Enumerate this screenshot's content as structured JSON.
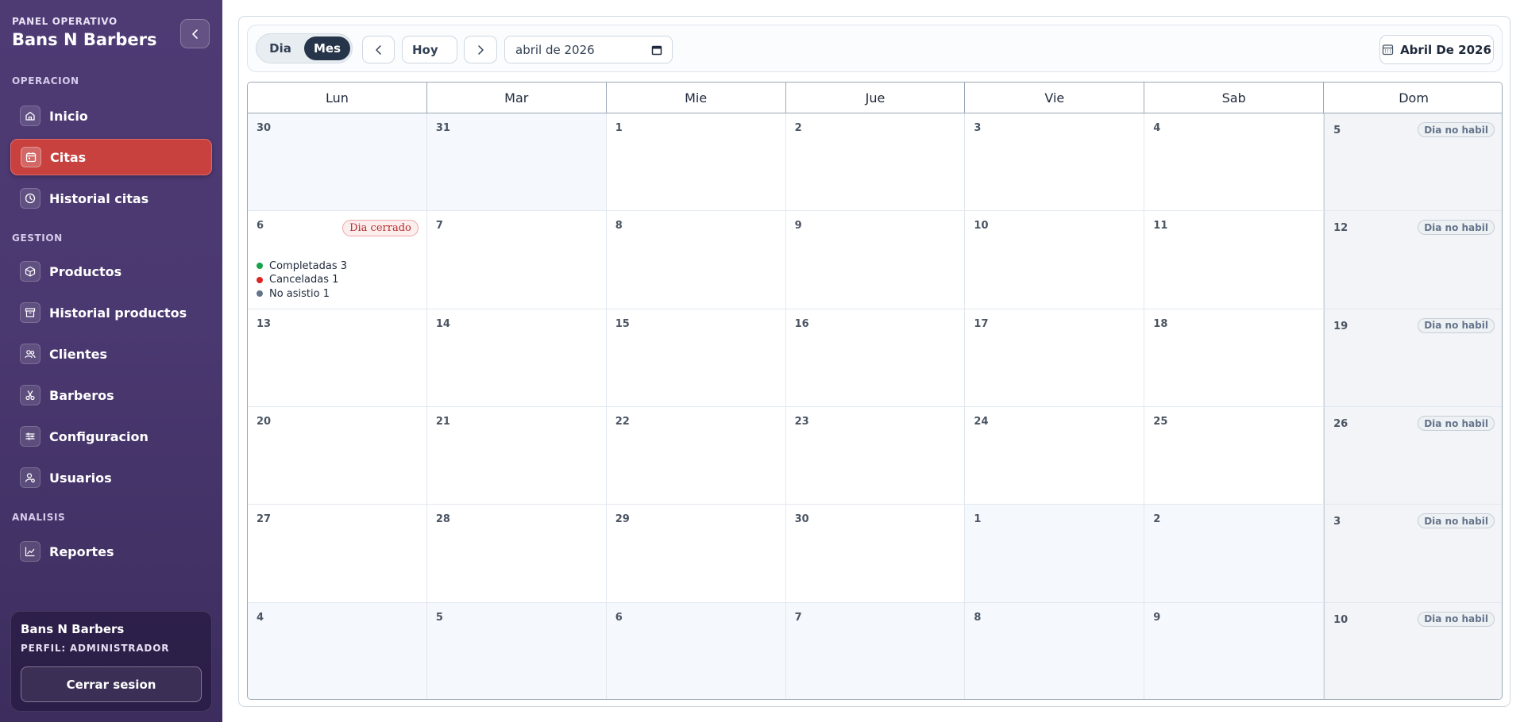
{
  "colors": {
    "sidebar_bg": "#4a3870",
    "active_item": "#c8413f",
    "toggle_active": "#263549",
    "status_completed": "#16a34a",
    "status_cancelled": "#dc2626",
    "status_noshow": "#64748b"
  },
  "sidebar": {
    "eyebrow": "PANEL OPERATIVO",
    "title": "Bans N Barbers",
    "sections": {
      "operacion": "OPERACION",
      "gestion": "GESTION",
      "analisis": "ANALISIS"
    },
    "items": [
      {
        "label": "Inicio",
        "icon": "home-icon"
      },
      {
        "label": "Citas",
        "icon": "calendar-icon",
        "active": true
      },
      {
        "label": "Historial citas",
        "icon": "clock-icon"
      },
      {
        "label": "Productos",
        "icon": "box-icon"
      },
      {
        "label": "Historial productos",
        "icon": "archive-icon"
      },
      {
        "label": "Clientes",
        "icon": "users-icon"
      },
      {
        "label": "Barberos",
        "icon": "scissors-icon"
      },
      {
        "label": "Configuracion",
        "icon": "sliders-icon"
      },
      {
        "label": "Usuarios",
        "icon": "user-cog-icon"
      },
      {
        "label": "Reportes",
        "icon": "chart-line-icon"
      }
    ],
    "profile": {
      "name": "Bans N Barbers",
      "role": "PERFIL: ADMINISTRADOR",
      "logout": "Cerrar sesion"
    }
  },
  "toolbar": {
    "view_day": "Dia",
    "view_month": "Mes",
    "today": "Hoy",
    "date_value": "abril de 2026",
    "month_badge": "Abril De 2026"
  },
  "calendar": {
    "weekdays": [
      "Lun",
      "Mar",
      "Mie",
      "Jue",
      "Vie",
      "Sab",
      "Dom"
    ],
    "weeks": [
      [
        {
          "d": "30",
          "out": true
        },
        {
          "d": "31",
          "out": true
        },
        {
          "d": "1"
        },
        {
          "d": "2"
        },
        {
          "d": "3"
        },
        {
          "d": "4"
        },
        {
          "d": "5",
          "tag": "Dia no habil"
        }
      ],
      [
        {
          "d": "6",
          "closed": "Dia cerrado",
          "stats": [
            {
              "label": "Completadas 3",
              "status": "completed"
            },
            {
              "label": "Canceladas 1",
              "status": "cancelled"
            },
            {
              "label": "No asistio 1",
              "status": "noshow"
            }
          ]
        },
        {
          "d": "7"
        },
        {
          "d": "8"
        },
        {
          "d": "9"
        },
        {
          "d": "10"
        },
        {
          "d": "11"
        },
        {
          "d": "12",
          "tag": "Dia no habil"
        }
      ],
      [
        {
          "d": "13"
        },
        {
          "d": "14"
        },
        {
          "d": "15"
        },
        {
          "d": "16"
        },
        {
          "d": "17"
        },
        {
          "d": "18"
        },
        {
          "d": "19",
          "tag": "Dia no habil"
        }
      ],
      [
        {
          "d": "20"
        },
        {
          "d": "21"
        },
        {
          "d": "22"
        },
        {
          "d": "23"
        },
        {
          "d": "24"
        },
        {
          "d": "25"
        },
        {
          "d": "26",
          "tag": "Dia no habil"
        }
      ],
      [
        {
          "d": "27"
        },
        {
          "d": "28"
        },
        {
          "d": "29"
        },
        {
          "d": "30"
        },
        {
          "d": "1",
          "out": true
        },
        {
          "d": "2",
          "out": true
        },
        {
          "d": "3",
          "tag": "Dia no habil"
        }
      ],
      [
        {
          "d": "4",
          "out": true
        },
        {
          "d": "5",
          "out": true
        },
        {
          "d": "6",
          "out": true
        },
        {
          "d": "7",
          "out": true
        },
        {
          "d": "8",
          "out": true
        },
        {
          "d": "9",
          "out": true
        },
        {
          "d": "10",
          "tag": "Dia no habil"
        }
      ]
    ]
  }
}
